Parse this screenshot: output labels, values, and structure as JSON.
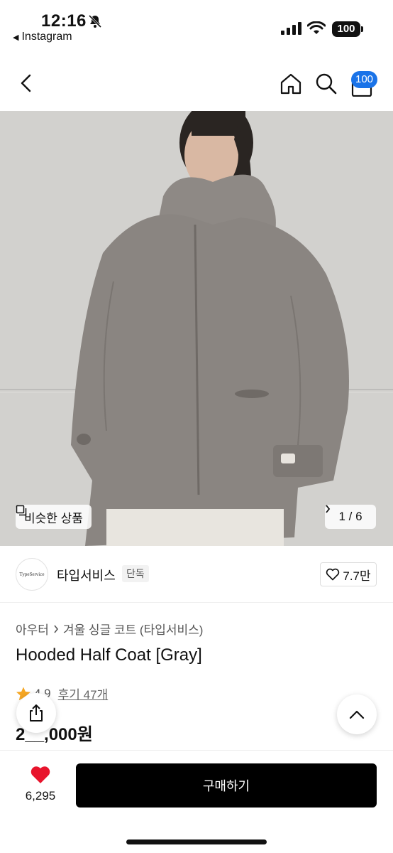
{
  "status_bar": {
    "time": "12:16",
    "back_app": "Instagram",
    "battery": "100"
  },
  "nav": {
    "cart_count": "100"
  },
  "hero": {
    "similar_label": "비슷한 상품",
    "page_indicator": "1 / 6"
  },
  "brand": {
    "logo_text": "TypeService",
    "name": "타입서비스",
    "tag": "단독",
    "likes": "7.7만"
  },
  "product": {
    "breadcrumb": [
      "아우터",
      "겨울 싱글 코트 (타입서비스)"
    ],
    "title": "Hooded Half Coat [Gray]",
    "rating": "4.9",
    "reviews": "후기 47개",
    "price": "2__,000원"
  },
  "bottom": {
    "wish_count": "6,295",
    "buy_label": "구매하기"
  },
  "colors": {
    "accent_badge": "#1a73e8",
    "heart": "#e8142c",
    "star": "#f5a623",
    "buy_button": "#000000"
  },
  "icons": [
    "bell-off-icon",
    "signal-icon",
    "wifi-icon",
    "back-arrow-icon",
    "home-icon",
    "search-icon",
    "bag-icon",
    "gallery-icon",
    "chevron-right-icon",
    "heart-outline-icon",
    "star-icon",
    "share-icon",
    "chevron-up-icon",
    "heart-filled-icon"
  ]
}
